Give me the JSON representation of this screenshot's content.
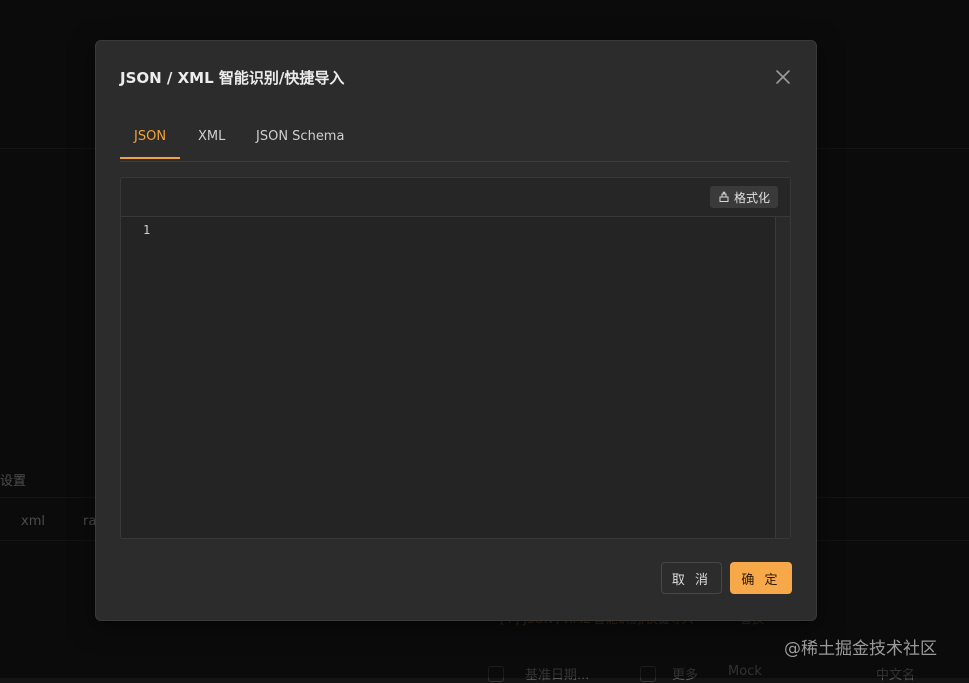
{
  "background": {
    "section_label": "设置",
    "body_type_tabs": [
      "xml",
      "ra"
    ],
    "import_link": "[+] JSON / XML 智能识别/快捷导入",
    "replace_link": "替换",
    "base_date_select": "基准日期...",
    "more_label": "更多",
    "mock_label": "Mock",
    "language_label": "中文名"
  },
  "dialog": {
    "title": "JSON / XML 智能识别/快捷导入",
    "close_icon": "close-icon",
    "tabs": [
      {
        "label": "JSON",
        "active": true
      },
      {
        "label": "XML",
        "active": false
      },
      {
        "label": "JSON Schema",
        "active": false
      }
    ],
    "editor": {
      "format_label": "格式化",
      "format_icon": "format-icon",
      "line_numbers": [
        "1"
      ],
      "content": ""
    },
    "cancel_label": "取 消",
    "ok_label": "确 定"
  },
  "watermark": "@稀土掘金技术社区",
  "colors": {
    "accent": "#f7a94a",
    "tab_active": "#f0a33c",
    "dialog_bg": "#2c2c2c",
    "page_bg": "#141414"
  }
}
